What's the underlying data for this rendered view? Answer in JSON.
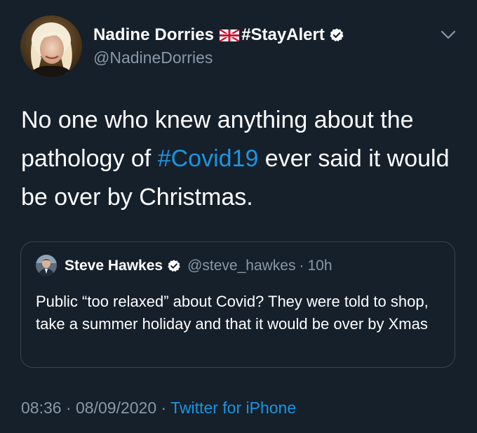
{
  "author": {
    "display_name": "Nadine Dorries",
    "flag_icon": "uk-flag-icon",
    "name_hashtag": "#StayAlert",
    "verified_icon": "verified-badge-icon",
    "handle": "@NadineDorries"
  },
  "tweet": {
    "text_before": "No one who knew anything about the pathology of ",
    "hashtag": "#Covid19",
    "text_after": " ever said it would be over by Christmas."
  },
  "quoted_tweet": {
    "display_name": "Steve Hawkes",
    "verified_icon": "verified-badge-icon",
    "handle": "@steve_hawkes",
    "separator": "·",
    "time": "10h",
    "text": "Public “too relaxed” about Covid? They were told to shop, take a summer holiday and that it would be over by Xmas"
  },
  "meta": {
    "time": "08:36",
    "separator1": " · ",
    "date": "08/09/2020",
    "separator2": " · ",
    "source": "Twitter for iPhone"
  },
  "colors": {
    "background": "#15202b",
    "link": "#1b95e0",
    "secondary_text": "#8899a6",
    "border": "#38444d"
  },
  "icons": {
    "menu": "chevron-down-icon"
  }
}
